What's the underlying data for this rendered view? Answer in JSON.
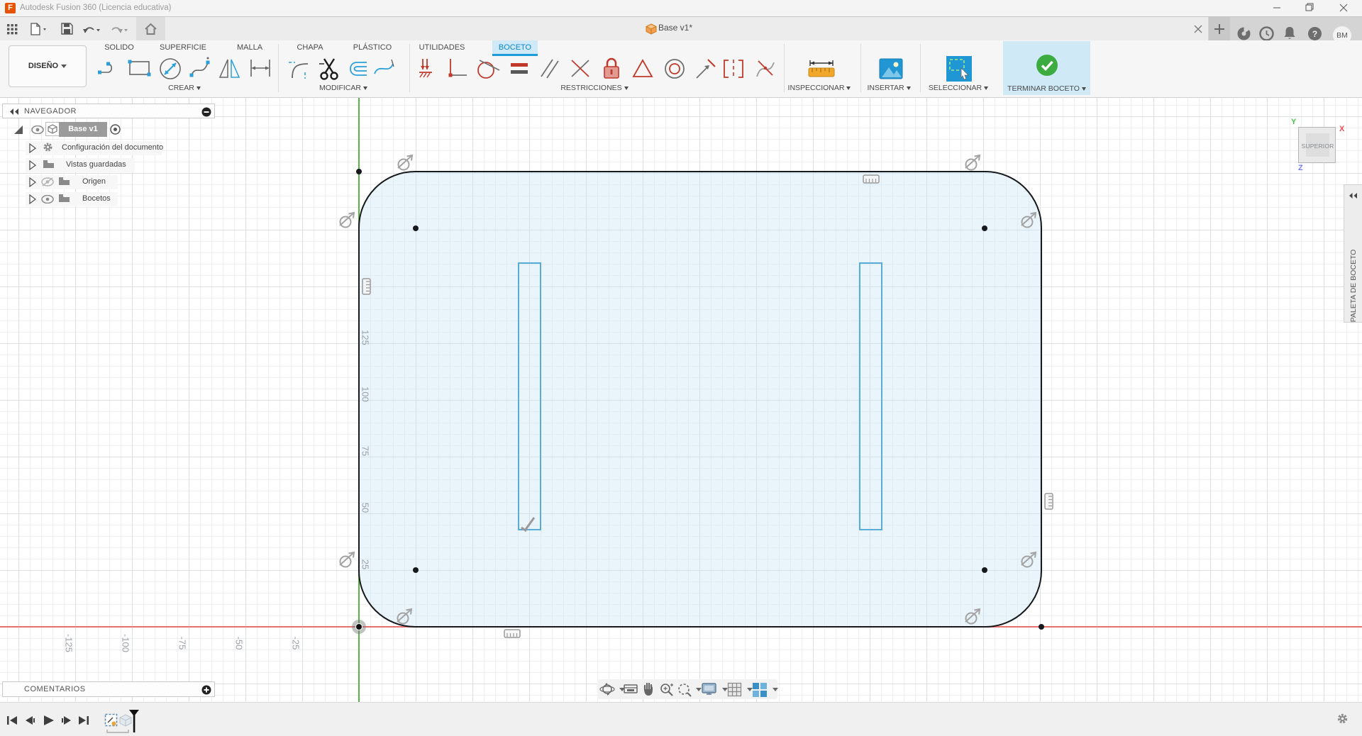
{
  "title_bar": {
    "app_title": "Autodesk Fusion 360 (Licencia educativa)",
    "logo_letter": "F"
  },
  "document_tab": {
    "title": "Base v1*"
  },
  "account": {
    "initials": "BM"
  },
  "ribbon": {
    "workspace_label": "DISEÑO",
    "tabs": [
      "SOLIDO",
      "SUPERFICIE",
      "MALLA",
      "CHAPA",
      "PLÁSTICO",
      "UTILIDADES",
      "BOCETO"
    ],
    "active_tab": "BOCETO",
    "group_labels": {
      "create": "CREAR",
      "modify": "MODIFICAR",
      "constraints": "RESTRICCIONES",
      "inspect": "INSPECCIONAR",
      "insert": "INSERTAR",
      "select": "SELECCIONAR",
      "finish_sketch": "TERMINAR BOCETO"
    }
  },
  "navigator": {
    "header": "NAVEGADOR",
    "items": [
      {
        "label": "Base v1",
        "selected": true
      },
      {
        "label": "Configuración del documento"
      },
      {
        "label": "Vistas guardadas"
      },
      {
        "label": "Origen",
        "visible": false
      },
      {
        "label": "Bocetos",
        "visible": true
      }
    ]
  },
  "viewcube": {
    "face_label": "SUPERIOR",
    "axis_x": "X",
    "axis_y": "Y",
    "axis_z": "Z"
  },
  "sketch_palette_tab": "PALETA DE BOCETO",
  "canvas": {
    "ruler_y_labels": [
      "125",
      "100",
      "75",
      "50",
      "25"
    ],
    "ruler_x_labels": [
      "-125",
      "-100",
      "-75",
      "-50",
      "-25"
    ]
  },
  "comments_panel": {
    "header": "COMENTARIOS"
  },
  "colors": {
    "accent_blue": "#1b9bd8",
    "constraint_red": "#c0392b",
    "axis_green": "#57b347",
    "axis_red": "#e87070",
    "profile_fill": "#d6e9f7",
    "slot_stroke": "#58acd8",
    "finish_green": "#3cab40"
  }
}
